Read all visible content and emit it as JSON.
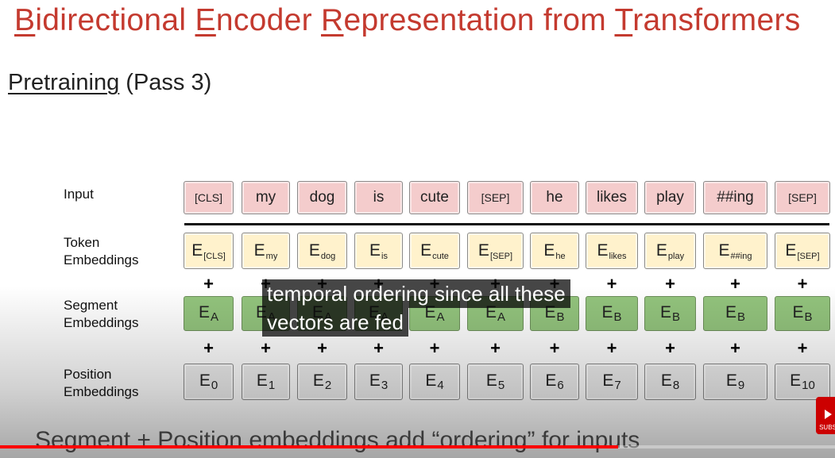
{
  "slide": {
    "title_parts": [
      {
        "cap": "B",
        "rest": "idirectional "
      },
      {
        "cap": "E",
        "rest": "ncoder "
      },
      {
        "cap": "R",
        "rest": "epresentation from "
      },
      {
        "cap": "T",
        "rest": "ransformers"
      }
    ],
    "subtitle_underlined": "Pretraining",
    "subtitle_rest": " (Pass 3)",
    "row_labels": {
      "input": "Input",
      "token_1": "Token",
      "token_2": "Embeddings",
      "segment_1": "Segment",
      "segment_2": "Embeddings",
      "position_1": "Position",
      "position_2": "Embeddings"
    },
    "inputs": [
      "[CLS]",
      "my",
      "dog",
      "is",
      "cute",
      "[SEP]",
      "he",
      "likes",
      "play",
      "##ing",
      "[SEP]"
    ],
    "token_subs": [
      "[CLS]",
      "my",
      "dog",
      "is",
      "cute",
      "[SEP]",
      "he",
      "likes",
      "play",
      "##ing",
      "[SEP]"
    ],
    "segment_subs": [
      "A",
      "A",
      "A",
      "A",
      "A",
      "A",
      "B",
      "B",
      "B",
      "B",
      "B"
    ],
    "position_subs": [
      "0",
      "1",
      "2",
      "3",
      "4",
      "5",
      "6",
      "7",
      "8",
      "9",
      "10"
    ],
    "embedding_letter": "E",
    "plus_symbol": "+",
    "bottom_text": "Segment + Position embeddings add “ordering” for inputs"
  },
  "player": {
    "captions": [
      "temporal ordering since all these",
      "vectors are fed"
    ],
    "progress": 0.74,
    "progress_color": "#ff0000",
    "subscribe_label": "SUBS"
  },
  "colors": {
    "title": "#c43a2f",
    "input_fill": "#f4cccc",
    "token_fill": "#fff2cc",
    "segment_fill": "#93c47d",
    "position_fill": "#efefef"
  }
}
